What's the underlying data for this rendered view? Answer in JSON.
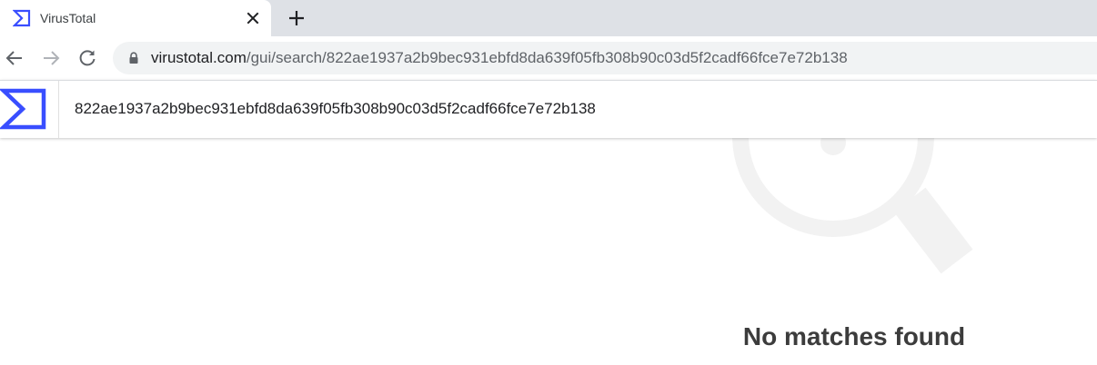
{
  "browser": {
    "tab": {
      "title": "VirusTotal",
      "favicon": "virustotal-sigma-icon"
    },
    "address_bar": {
      "domain": "virustotal.com",
      "path": "/gui/search/822ae1937a2b9bec931ebfd8da639f05fb308b90c03d5f2cadf66fce7e72b138"
    },
    "icons": [
      "close-icon",
      "plus-icon",
      "back-arrow-icon",
      "forward-arrow-icon",
      "reload-icon",
      "lock-icon"
    ]
  },
  "header": {
    "logo": "virustotal-sigma-logo",
    "search_value": "822ae1937a2b9bec931ebfd8da639f05fb308b90c03d5f2cadf66fce7e72b138"
  },
  "main": {
    "empty_state_icon": "magnifier-icon",
    "message": "No matches found"
  },
  "colors": {
    "brand_blue": "#394eff",
    "tabstrip": "#dee1e6",
    "omnibox": "#f1f3f4",
    "illustration": "#f2f2f2"
  }
}
